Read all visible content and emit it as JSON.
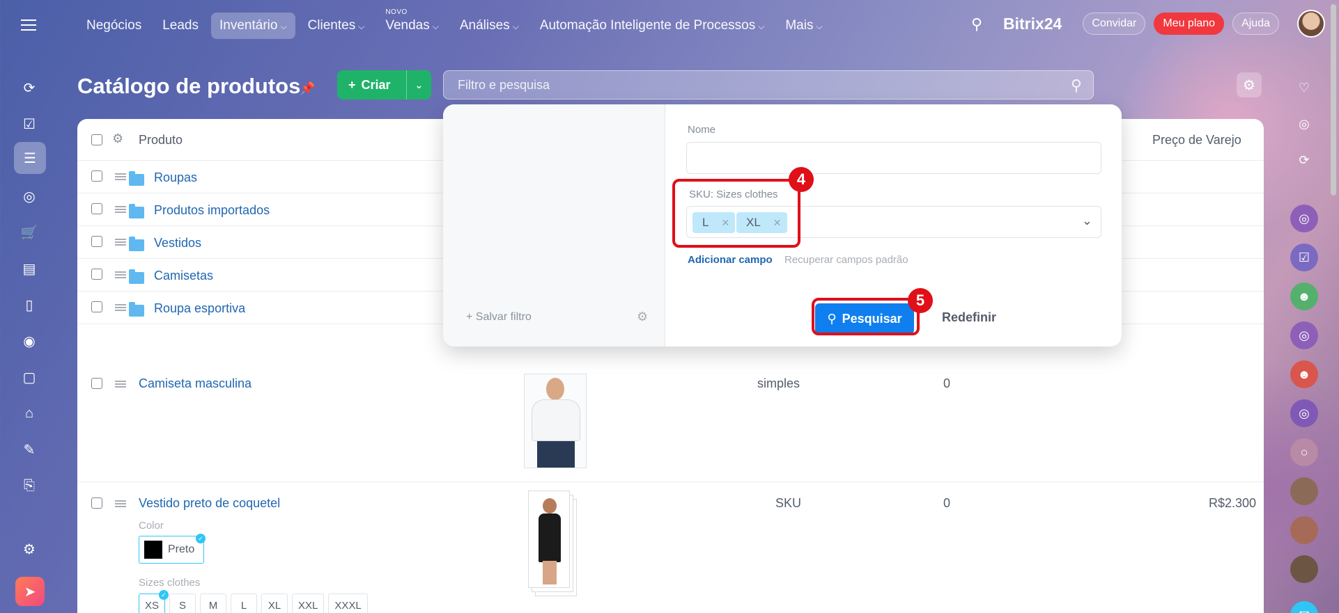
{
  "topbar": {
    "menu_icon": "hamburger-icon",
    "nav": [
      {
        "label": "Negócios",
        "chevron": false,
        "active": false,
        "badge": ""
      },
      {
        "label": "Leads",
        "chevron": false,
        "active": false,
        "badge": ""
      },
      {
        "label": "Inventário",
        "chevron": true,
        "active": true,
        "badge": ""
      },
      {
        "label": "Clientes",
        "chevron": true,
        "active": false,
        "badge": ""
      },
      {
        "label": "Vendas",
        "chevron": true,
        "active": false,
        "badge": "NOVO"
      },
      {
        "label": "Análises",
        "chevron": true,
        "active": false,
        "badge": ""
      },
      {
        "label": "Automação Inteligente de Processos",
        "chevron": true,
        "active": false,
        "badge": ""
      },
      {
        "label": "Mais",
        "chevron": true,
        "active": false,
        "badge": ""
      }
    ],
    "brand": "Bitrix24",
    "invite": "Convidar",
    "plan": "Meu plano",
    "help": "Ajuda"
  },
  "page": {
    "title": "Catálogo de produtos",
    "create_label": "Criar",
    "filter_placeholder": "Filtro e pesquisa"
  },
  "table": {
    "header_product": "Produto",
    "header_retail_price": "Preço de Varejo",
    "folders": [
      "Roupas",
      "Produtos importados",
      "Vestidos",
      "Camisetas",
      "Roupa esportiva"
    ],
    "products": [
      {
        "name": "Camiseta masculina",
        "type": "simples",
        "qty": "0",
        "price": ""
      },
      {
        "name": "Vestido preto de coquetel",
        "type": "SKU",
        "qty": "0",
        "price": "R$2.300"
      }
    ],
    "color_label": "Color",
    "color_value": "Preto",
    "sizes_label": "Sizes clothes",
    "sizes": [
      "XS",
      "S",
      "M",
      "L",
      "XL",
      "XXL",
      "XXXL"
    ],
    "selected_size": "XS"
  },
  "filter_popup": {
    "save_filter": "Salvar filtro",
    "name_label": "Nome",
    "name_value": "",
    "sku_label": "SKU: Sizes clothes",
    "tags": [
      "L",
      "XL"
    ],
    "add_field": "Adicionar campo",
    "restore_fields": "Recuperar campos padrão",
    "search_button": "Pesquisar",
    "reset_button": "Redefinir"
  },
  "annotations": {
    "step_sku": "4",
    "step_search": "5",
    "color": "#e00f18"
  },
  "colors": {
    "accent_green": "#1fb36a",
    "link_blue": "#2067b0",
    "button_blue": "#0f7ff0",
    "plan_red": "#f0383e"
  }
}
